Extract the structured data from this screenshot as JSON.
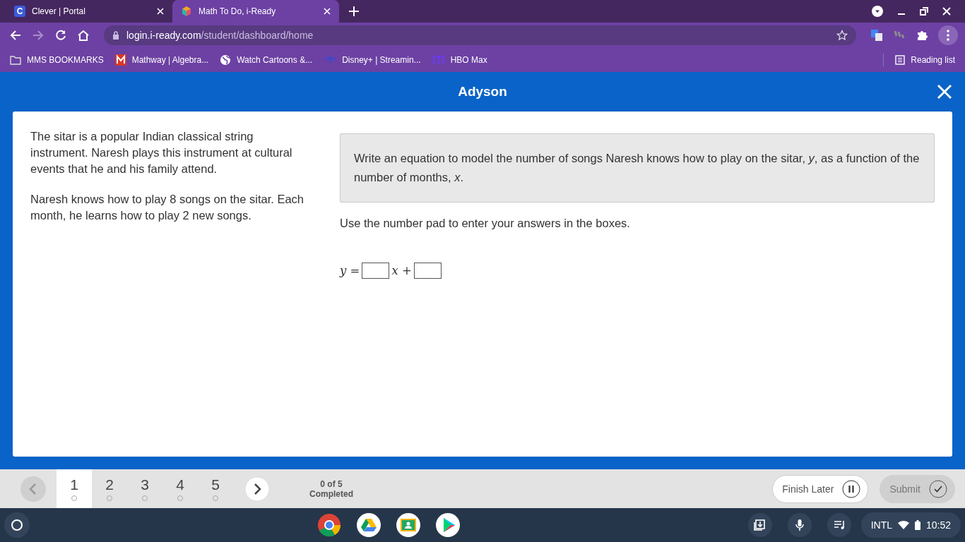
{
  "browser": {
    "tabs": [
      {
        "title": "Clever | Portal",
        "icon": "C",
        "selected": false
      },
      {
        "title": "Math To Do, i-Ready",
        "selected": true
      }
    ],
    "url_host": "login.i-ready.com",
    "url_path": "/student/dashboard/home",
    "bookmarks": [
      {
        "label": "MMS BOOKMARKS",
        "kind": "folder"
      },
      {
        "label": "Mathway | Algebra...",
        "kind": "mathway"
      },
      {
        "label": "Watch Cartoons &...",
        "kind": "globe"
      },
      {
        "label": "Disney+ | Streamin...",
        "kind": "disney"
      },
      {
        "label": "HBO Max",
        "kind": "hbo"
      }
    ],
    "reading_list": "Reading list"
  },
  "header": {
    "title": "Adyson"
  },
  "passage": [
    "The sitar is a popular Indian classical string instrument. Naresh plays this instrument at cultural events that he and his family attend.",
    "Naresh knows how to play 8 songs on the sitar. Each month, he learns how to play 2 new songs."
  ],
  "prompt": "Write an equation to model the number of songs Naresh knows how to play on the sitar, *y*, as a function of the number of months, *x*.",
  "instruction": "Use the number pad to enter your answers in the boxes.",
  "equation": [
    {
      "kind": "math",
      "text": "y ="
    },
    {
      "kind": "box"
    },
    {
      "kind": "math",
      "text": "x +"
    },
    {
      "kind": "box"
    }
  ],
  "nav": {
    "questions": [
      {
        "label": "1",
        "selected": true
      },
      {
        "label": "2",
        "selected": false
      },
      {
        "label": "3",
        "selected": false
      },
      {
        "label": "4",
        "selected": false
      },
      {
        "label": "5",
        "selected": false
      }
    ],
    "progress": [
      "0 of 5",
      "Completed"
    ],
    "finish_later": "Finish Later",
    "submit": "Submit",
    "submit_disabled": true
  },
  "shelf": {
    "ime": "INTL",
    "time": "10:52"
  }
}
